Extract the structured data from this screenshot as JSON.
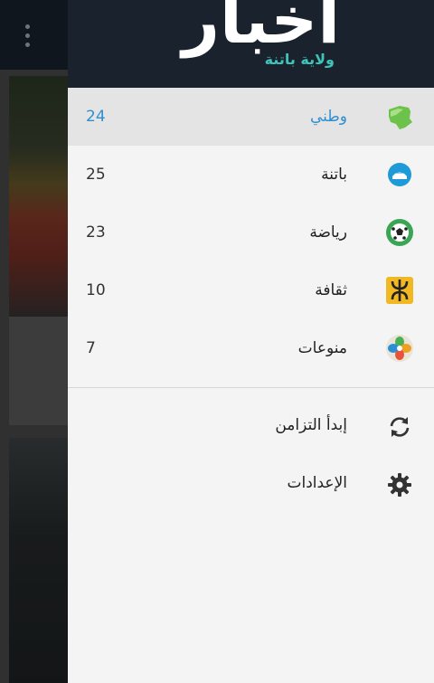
{
  "header": {
    "logo_text": "أخبار",
    "logo_subtitle": "ولاية باتنة"
  },
  "categories": [
    {
      "label": "وطني",
      "count": "24",
      "icon": "algeria-map-icon",
      "active": true
    },
    {
      "label": "باتنة",
      "count": "25",
      "icon": "batna-icon",
      "active": false
    },
    {
      "label": "رياضة",
      "count": "23",
      "icon": "soccer-ball-icon",
      "active": false
    },
    {
      "label": "ثقافة",
      "count": "10",
      "icon": "amazigh-symbol-icon",
      "active": false
    },
    {
      "label": "منوعات",
      "count": "7",
      "icon": "misc-flower-icon",
      "active": false
    }
  ],
  "actions": [
    {
      "label": "إبدأ التزامن",
      "icon": "sync-icon"
    },
    {
      "label": "الإعدادات",
      "icon": "settings-gear-icon"
    }
  ],
  "colors": {
    "header_bg": "#1a232d",
    "accent": "#2f8fd0",
    "logo_teal": "#3fc3b8"
  }
}
